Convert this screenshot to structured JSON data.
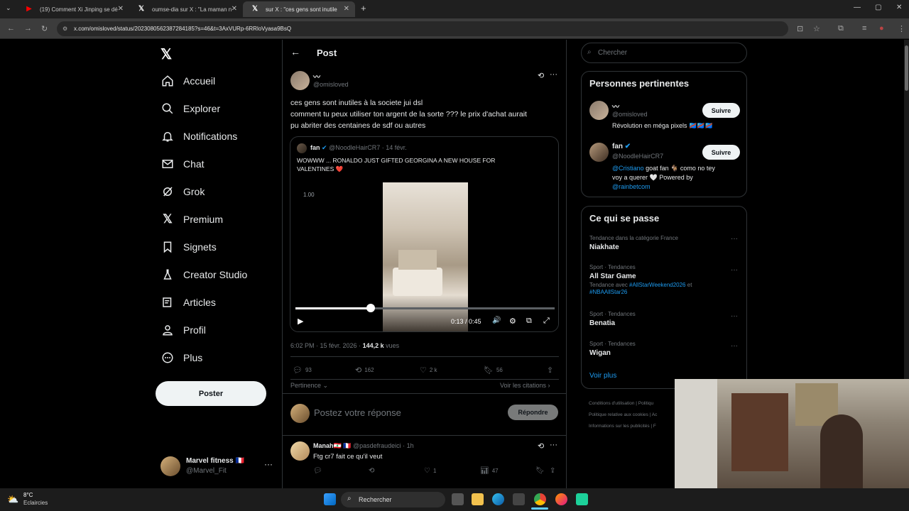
{
  "browser": {
    "tabs": [
      {
        "title": "(19) Comment Xi Jinping se dé"
      },
      {
        "title": "oumse-dia sur X : \"La maman n"
      },
      {
        "title": "sur X : \"ces gens sont inutile"
      }
    ],
    "url": "x.com/omisloved/status/2023080562387284185?s=46&t=3AxVURp-6RRloVyasa9BsQ"
  },
  "nav": {
    "items": [
      "Accueil",
      "Explorer",
      "Notifications",
      "Chat",
      "Grok",
      "Premium",
      "Signets",
      "Creator Studio",
      "Articles",
      "Profil",
      "Plus"
    ],
    "post_button": "Poster",
    "account_name": "Marvel fitness 🇫🇷",
    "account_handle": "@Marvel_Fit"
  },
  "post": {
    "header_title": "Post",
    "author_name": "〰",
    "author_handle": "@omisloved",
    "text_line1": "ces gens sont inutiles à la societe jui dsl",
    "text_line2": "comment tu peux utiliser ton argent de la sorte ??? le prix d'achat aurait",
    "text_line3": "pu abriter des centaines de sdf ou autres",
    "quote_author": "fan",
    "quote_handle": "@NoodleHairCR7",
    "quote_date": "· 14 févr.",
    "quote_text1": "WOWWW ... RONALDO JUST GIFTED GEORGINA A NEW HOUSE FOR",
    "quote_text2": "VALENTINES ❤️",
    "video_speed": "1.00",
    "video_time": "0:13 / 0:45",
    "video_progress": 0.29,
    "timestamp": "6:02 PM · 15 févr. 2026 ·",
    "views_count": "144,2 k",
    "views_label": "vues",
    "replies": "93",
    "reposts": "162",
    "likes": "2 k",
    "bookmarks": "56",
    "sort_label": "Pertinence",
    "quotes_link": "Voir les citations",
    "reply_placeholder": "Postez votre réponse",
    "reply_button": "Répondre"
  },
  "reply": {
    "author": "Manah🇱🇧 🇫🇷",
    "handle": "@pasdefraudeici",
    "time": "· 1h",
    "text": "Ftg cr7 fait ce qu'il veut",
    "likes": "1",
    "views": "47"
  },
  "sidebar": {
    "search_placeholder": "Chercher",
    "relevant_title": "Personnes pertinentes",
    "people": [
      {
        "name": "〰",
        "handle": "@omisloved",
        "bio": "Révolution en méga pixels 🇨🇩🇨🇩🇨🇩",
        "follow": "Suivre"
      },
      {
        "name": "fan",
        "handle": "@NoodleHairCR7",
        "bio_mention": "@Cristiano",
        "bio_mid": " goat fan 🐐 como no tey",
        "bio_line2": "voy a querer 🤍 Powered by",
        "bio_mention2": "@rainbetcom",
        "follow": "Suivre"
      }
    ],
    "trends_title": "Ce qui se passe",
    "trends": [
      {
        "meta": "Tendance dans la catégorie France",
        "name": "Niakhate"
      },
      {
        "meta": "Sport · Tendances",
        "name": "All Star Game",
        "extra_prefix": "Tendance avec ",
        "extra_tag1": "#AllStarWeekend2026",
        "extra_mid": " et",
        "extra_tag2": "#NBAAllStar26"
      },
      {
        "meta": "Sport · Tendances",
        "name": "Benatia"
      },
      {
        "meta": "Sport · Tendances",
        "name": "Wigan"
      }
    ],
    "show_more": "Voir plus",
    "footer1": "Conditions d'utilisation | Politiqu",
    "footer2": "Politique relative aux cookies | Ac",
    "footer3": "Informations sur les publicités | F"
  },
  "taskbar": {
    "weather_temp": "8°C",
    "weather_desc": "Eclaircies",
    "search": "Rechercher"
  }
}
